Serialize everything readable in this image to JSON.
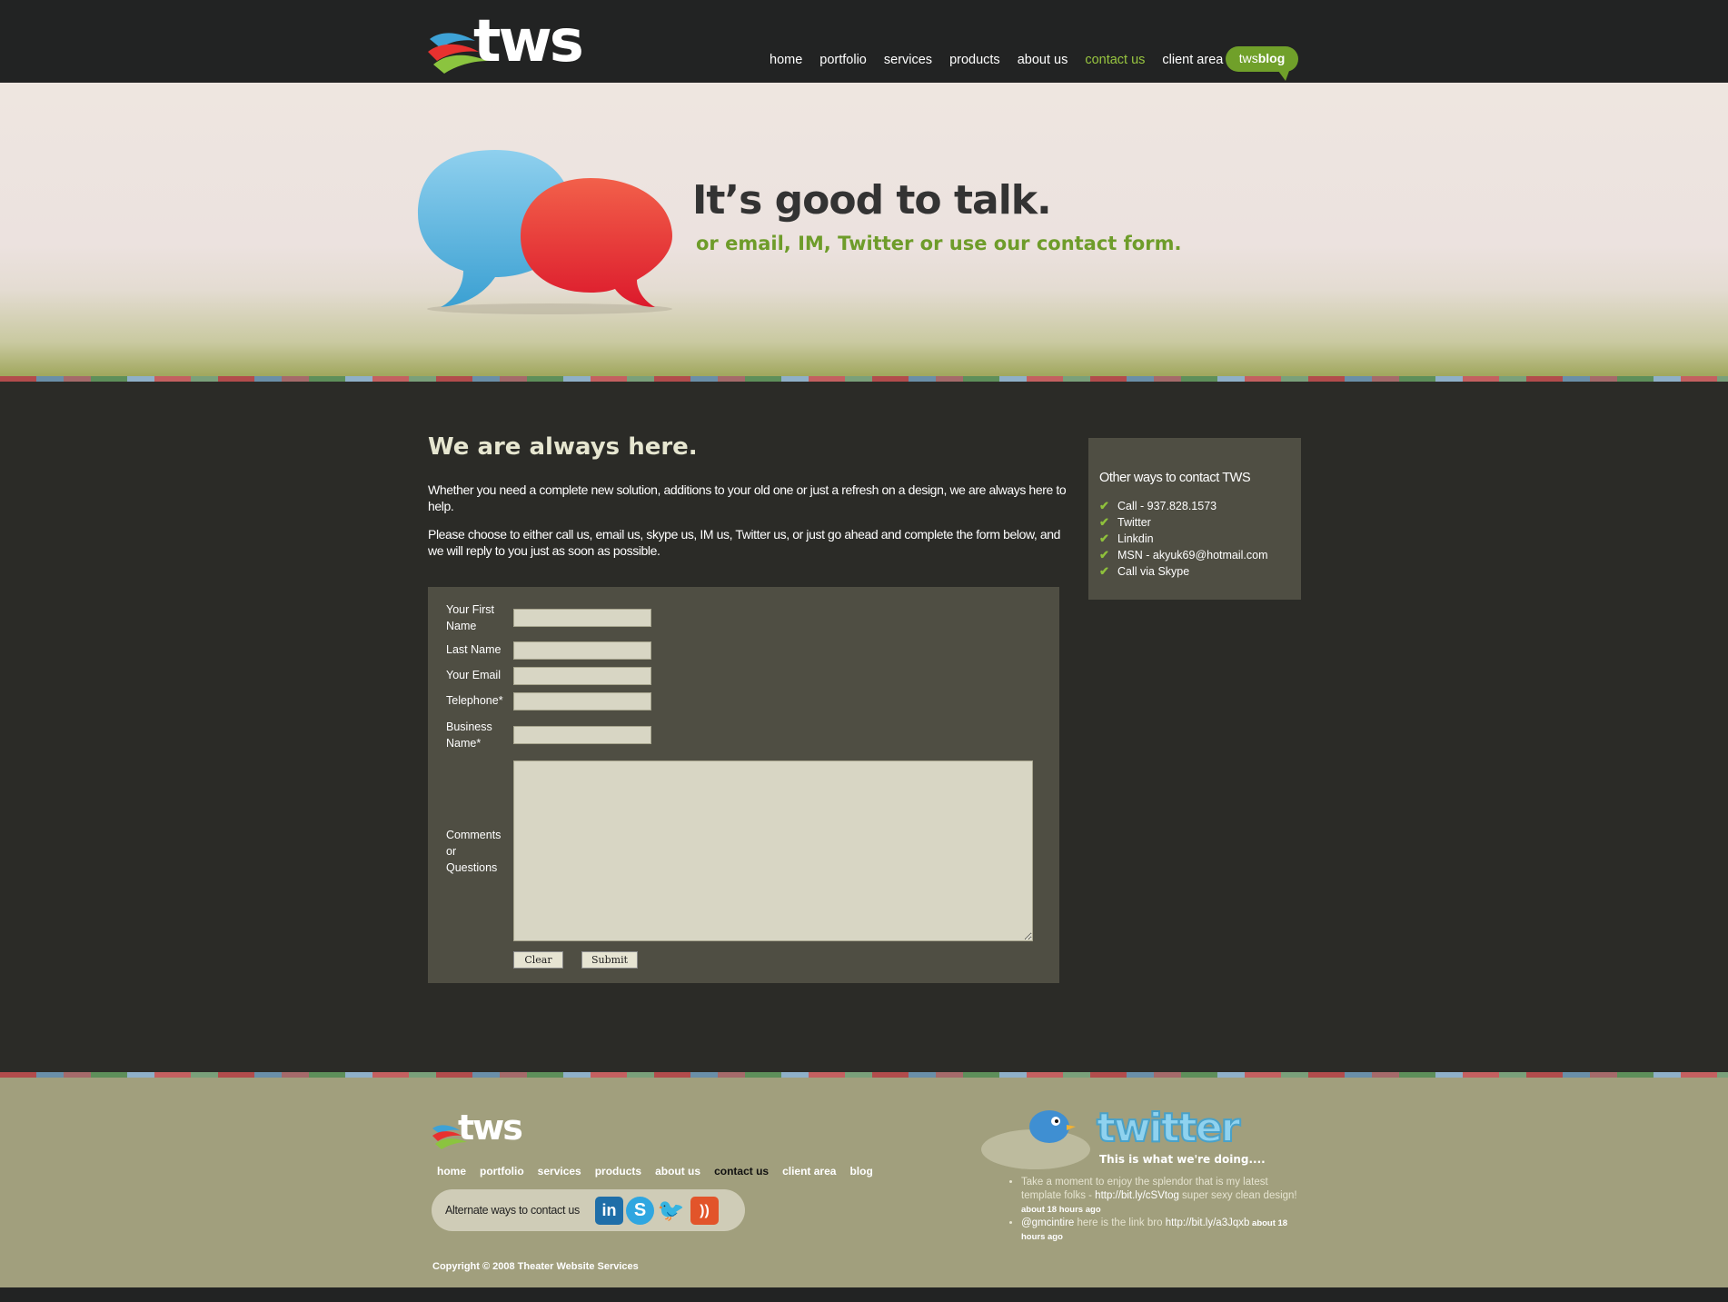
{
  "header": {
    "logo_text": "tws",
    "nav": [
      "home",
      "portfolio",
      "services",
      "products",
      "about us",
      "contact us",
      "client area"
    ],
    "active_nav": "contact us",
    "blog_button": {
      "prefix": "tws",
      "strong": "blog"
    }
  },
  "hero": {
    "headline": "It’s good to talk.",
    "subline": "or email, IM, Twitter or use our contact form."
  },
  "main": {
    "title": "We are always here.",
    "paragraph1": "Whether you need a complete new solution, additions to your old one or just a refresh on a design, we are always here to help.",
    "paragraph2": "Please choose to either call us, email us, skype us, IM us, Twitter us, or just go ahead and complete the form below, and we will reply to you just as soon as possible."
  },
  "form": {
    "first_name_label": "Your First Name",
    "last_name_label": "Last Name",
    "email_label": "Your Email",
    "telephone_label": "Telephone*",
    "business_label": "Business Name*",
    "comments_label": "Comments or Questions",
    "first_name_value": "",
    "last_name_value": "",
    "email_value": "",
    "telephone_value": "",
    "business_value": "",
    "comments_value": "",
    "clear_label": "Clear",
    "submit_label": "Submit"
  },
  "sidebar": {
    "title": "Other ways to contact TWS",
    "items": [
      {
        "label": "Call - 937.828.1573",
        "link": false
      },
      {
        "label": "Twitter",
        "link": true
      },
      {
        "label": "Linkdin",
        "link": true
      },
      {
        "label": "MSN - akyuk69@hotmail.com",
        "link": false
      },
      {
        "label": "Call via Skype",
        "link": true
      }
    ]
  },
  "footer": {
    "logo_text": "tws",
    "nav": [
      "home",
      "portfolio",
      "services",
      "products",
      "about us",
      "contact us",
      "client area",
      "blog"
    ],
    "active_nav": "contact us",
    "alt_contact_text": "Alternate ways to contact us",
    "social_icons": [
      "linkedin-icon",
      "skype-icon",
      "twitter-bird-icon",
      "rss-icon"
    ],
    "copyright": "Copyright © 2008 Theater Website Services",
    "twitter_word": "twitter",
    "twitter_sub": "This is what we're doing....",
    "tweets": [
      {
        "pre": "Take a moment to enjoy the splendor that is my latest template folks - ",
        "link": "http://bit.ly/cSVtog",
        "post": " super sexy clean design! ",
        "ago": "about 18 hours ago"
      },
      {
        "pre": "",
        "handle": "@gmcintire",
        "mid": " here is the link bro ",
        "link": "http://bit.ly/a3Jqxb",
        "ago": " about 18 hours ago"
      }
    ]
  },
  "colors": {
    "header_bg": "#222323",
    "body_bg": "#2b2b27",
    "panel_bg": "#4f4e43",
    "footer_bg": "#a19f7d",
    "accent_green": "#98c540",
    "field_bg": "#d8d6c4"
  }
}
